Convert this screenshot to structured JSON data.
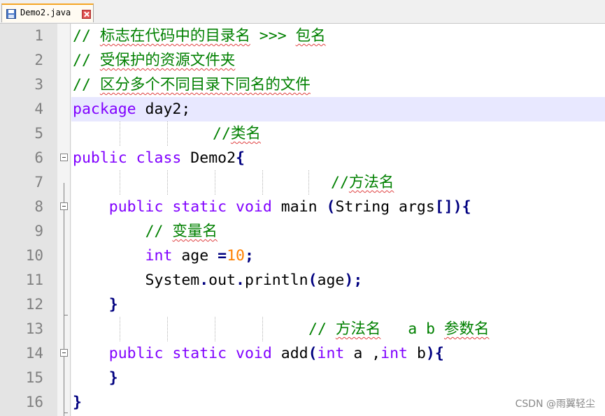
{
  "tab": {
    "title": "Demo2.java",
    "icon": "floppy-disk-icon"
  },
  "lines": [
    {
      "n": "1",
      "t": "// 标志在代码中的目录名 >>> 包名"
    },
    {
      "n": "2",
      "t": "// 受保护的资源文件夹"
    },
    {
      "n": "3",
      "t": "// 区分多个不同目录下同名的文件"
    },
    {
      "n": "4",
      "t": "package day2;"
    },
    {
      "n": "5",
      "t": "//类名"
    },
    {
      "n": "6",
      "t": "public class Demo2{"
    },
    {
      "n": "7",
      "t": "//方法名"
    },
    {
      "n": "8",
      "t": "public static void main (String args[]){"
    },
    {
      "n": "9",
      "t": "// 变量名"
    },
    {
      "n": "10",
      "t": "int age =10;"
    },
    {
      "n": "11",
      "t": "System.out.println(age);"
    },
    {
      "n": "12",
      "t": "}"
    },
    {
      "n": "13",
      "t": "// 方法名   a b 参数名"
    },
    {
      "n": "14",
      "t": "public static void add(int a ,int b){"
    },
    {
      "n": "15",
      "t": "}"
    },
    {
      "n": "16",
      "t": "}"
    }
  ],
  "current_line": "4",
  "watermark": "CSDN @雨翼轻尘",
  "colors": {
    "keyword": "#8000ff",
    "number": "#ff8000",
    "comment": "#008000",
    "current_line_bg": "#e8e8ff"
  }
}
